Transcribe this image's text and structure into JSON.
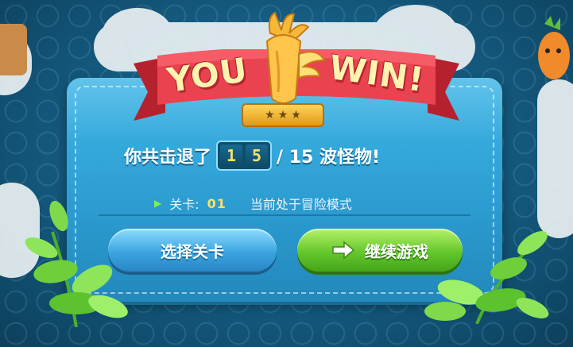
{
  "banner": {
    "left_word": "YOU",
    "right_word": "WIN!",
    "stars_icon": "three-stars-icon",
    "trophy_icon": "carrot-trophy-icon"
  },
  "result": {
    "label": "你共击退了",
    "kills_digits": [
      "1",
      "5"
    ],
    "total": "/ 15 波怪物!"
  },
  "level": {
    "label": "关卡:",
    "number": "01",
    "mode": "当前处于冒险模式"
  },
  "buttons": {
    "select_level": "选择关卡",
    "continue_game": "继续游戏"
  },
  "colors": {
    "panel": "#2b9bd0",
    "ribbon": "#e8434f",
    "select_button": "#3aa5e0",
    "continue_button": "#64c72b",
    "digit": "#ffe06a"
  }
}
